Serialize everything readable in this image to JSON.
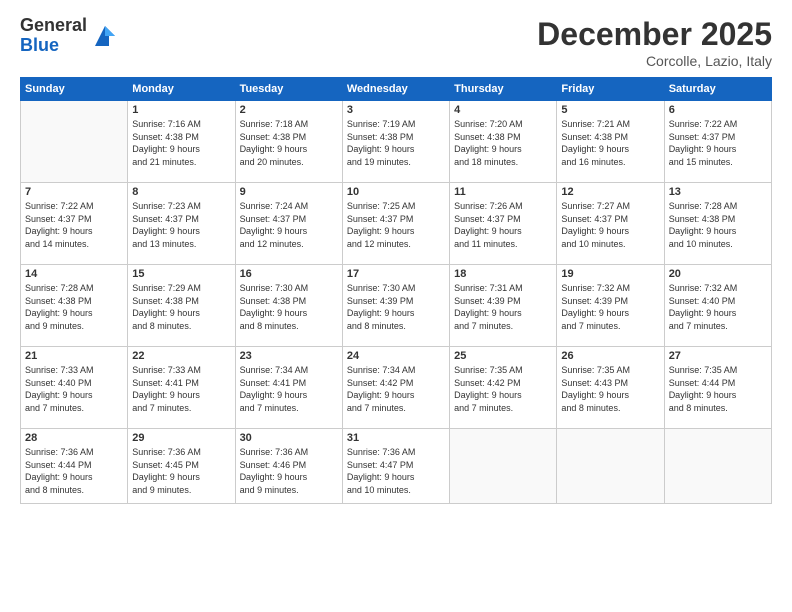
{
  "logo": {
    "general": "General",
    "blue": "Blue"
  },
  "title": "December 2025",
  "location": "Corcolle, Lazio, Italy",
  "weekdays": [
    "Sunday",
    "Monday",
    "Tuesday",
    "Wednesday",
    "Thursday",
    "Friday",
    "Saturday"
  ],
  "weeks": [
    [
      {
        "day": "",
        "info": ""
      },
      {
        "day": "1",
        "info": "Sunrise: 7:16 AM\nSunset: 4:38 PM\nDaylight: 9 hours\nand 21 minutes."
      },
      {
        "day": "2",
        "info": "Sunrise: 7:18 AM\nSunset: 4:38 PM\nDaylight: 9 hours\nand 20 minutes."
      },
      {
        "day": "3",
        "info": "Sunrise: 7:19 AM\nSunset: 4:38 PM\nDaylight: 9 hours\nand 19 minutes."
      },
      {
        "day": "4",
        "info": "Sunrise: 7:20 AM\nSunset: 4:38 PM\nDaylight: 9 hours\nand 18 minutes."
      },
      {
        "day": "5",
        "info": "Sunrise: 7:21 AM\nSunset: 4:38 PM\nDaylight: 9 hours\nand 16 minutes."
      },
      {
        "day": "6",
        "info": "Sunrise: 7:22 AM\nSunset: 4:37 PM\nDaylight: 9 hours\nand 15 minutes."
      }
    ],
    [
      {
        "day": "7",
        "info": "Sunrise: 7:22 AM\nSunset: 4:37 PM\nDaylight: 9 hours\nand 14 minutes."
      },
      {
        "day": "8",
        "info": "Sunrise: 7:23 AM\nSunset: 4:37 PM\nDaylight: 9 hours\nand 13 minutes."
      },
      {
        "day": "9",
        "info": "Sunrise: 7:24 AM\nSunset: 4:37 PM\nDaylight: 9 hours\nand 12 minutes."
      },
      {
        "day": "10",
        "info": "Sunrise: 7:25 AM\nSunset: 4:37 PM\nDaylight: 9 hours\nand 12 minutes."
      },
      {
        "day": "11",
        "info": "Sunrise: 7:26 AM\nSunset: 4:37 PM\nDaylight: 9 hours\nand 11 minutes."
      },
      {
        "day": "12",
        "info": "Sunrise: 7:27 AM\nSunset: 4:37 PM\nDaylight: 9 hours\nand 10 minutes."
      },
      {
        "day": "13",
        "info": "Sunrise: 7:28 AM\nSunset: 4:38 PM\nDaylight: 9 hours\nand 10 minutes."
      }
    ],
    [
      {
        "day": "14",
        "info": "Sunrise: 7:28 AM\nSunset: 4:38 PM\nDaylight: 9 hours\nand 9 minutes."
      },
      {
        "day": "15",
        "info": "Sunrise: 7:29 AM\nSunset: 4:38 PM\nDaylight: 9 hours\nand 8 minutes."
      },
      {
        "day": "16",
        "info": "Sunrise: 7:30 AM\nSunset: 4:38 PM\nDaylight: 9 hours\nand 8 minutes."
      },
      {
        "day": "17",
        "info": "Sunrise: 7:30 AM\nSunset: 4:39 PM\nDaylight: 9 hours\nand 8 minutes."
      },
      {
        "day": "18",
        "info": "Sunrise: 7:31 AM\nSunset: 4:39 PM\nDaylight: 9 hours\nand 7 minutes."
      },
      {
        "day": "19",
        "info": "Sunrise: 7:32 AM\nSunset: 4:39 PM\nDaylight: 9 hours\nand 7 minutes."
      },
      {
        "day": "20",
        "info": "Sunrise: 7:32 AM\nSunset: 4:40 PM\nDaylight: 9 hours\nand 7 minutes."
      }
    ],
    [
      {
        "day": "21",
        "info": "Sunrise: 7:33 AM\nSunset: 4:40 PM\nDaylight: 9 hours\nand 7 minutes."
      },
      {
        "day": "22",
        "info": "Sunrise: 7:33 AM\nSunset: 4:41 PM\nDaylight: 9 hours\nand 7 minutes."
      },
      {
        "day": "23",
        "info": "Sunrise: 7:34 AM\nSunset: 4:41 PM\nDaylight: 9 hours\nand 7 minutes."
      },
      {
        "day": "24",
        "info": "Sunrise: 7:34 AM\nSunset: 4:42 PM\nDaylight: 9 hours\nand 7 minutes."
      },
      {
        "day": "25",
        "info": "Sunrise: 7:35 AM\nSunset: 4:42 PM\nDaylight: 9 hours\nand 7 minutes."
      },
      {
        "day": "26",
        "info": "Sunrise: 7:35 AM\nSunset: 4:43 PM\nDaylight: 9 hours\nand 8 minutes."
      },
      {
        "day": "27",
        "info": "Sunrise: 7:35 AM\nSunset: 4:44 PM\nDaylight: 9 hours\nand 8 minutes."
      }
    ],
    [
      {
        "day": "28",
        "info": "Sunrise: 7:36 AM\nSunset: 4:44 PM\nDaylight: 9 hours\nand 8 minutes."
      },
      {
        "day": "29",
        "info": "Sunrise: 7:36 AM\nSunset: 4:45 PM\nDaylight: 9 hours\nand 9 minutes."
      },
      {
        "day": "30",
        "info": "Sunrise: 7:36 AM\nSunset: 4:46 PM\nDaylight: 9 hours\nand 9 minutes."
      },
      {
        "day": "31",
        "info": "Sunrise: 7:36 AM\nSunset: 4:47 PM\nDaylight: 9 hours\nand 10 minutes."
      },
      {
        "day": "",
        "info": ""
      },
      {
        "day": "",
        "info": ""
      },
      {
        "day": "",
        "info": ""
      }
    ]
  ]
}
